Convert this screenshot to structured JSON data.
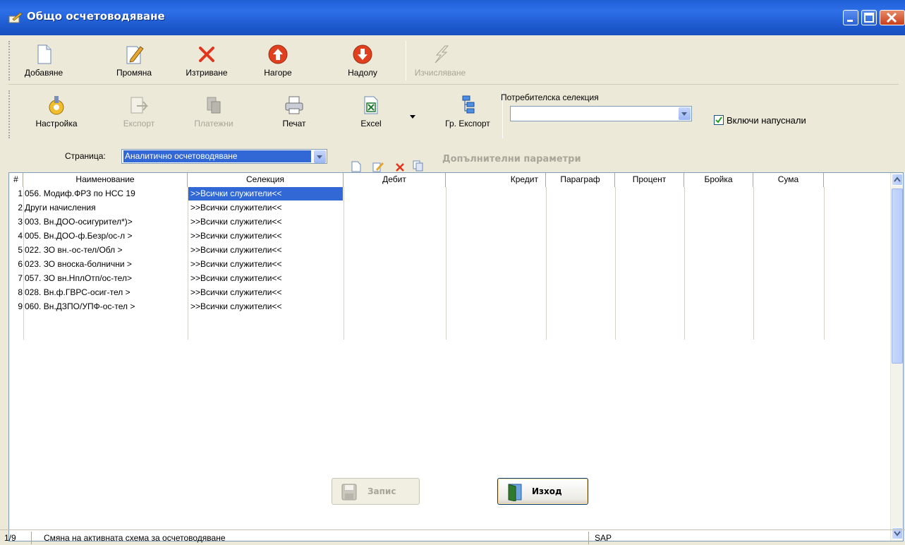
{
  "window": {
    "title": "Общо осчетоводяване"
  },
  "toolbar1": {
    "add": "Добавяне",
    "edit": "Промяна",
    "delete": "Изтриване",
    "up": "Нагоре",
    "down": "Надолу",
    "calculate": "Изчисляване"
  },
  "toolbar2": {
    "settings": "Настройка",
    "export": "Експорт",
    "payments": "Платежни",
    "print": "Печат",
    "excel": "Excel",
    "group_export": "Гр. Експорт",
    "user_selection_label": "Потребителска селекция",
    "user_selection_value": "",
    "include_dismissed_label": "Включи напуснали",
    "include_dismissed_checked": true
  },
  "page": {
    "label": "Страница:",
    "value": "Аналитично осчетоводяване",
    "extra_params": "Допълнителни параметри"
  },
  "grid": {
    "columns": [
      "#",
      "Наименование",
      "Селекция",
      "Дебит",
      "Кредит",
      "Параграф",
      "Процент",
      "Бройка",
      "Сума"
    ],
    "rows": [
      {
        "num": "1",
        "name": "056. Модиф.ФРЗ по НСС 19",
        "selection": ">>Всички служители<<"
      },
      {
        "num": "2",
        "name": "Други начисления",
        "selection": ">>Всички служители<<"
      },
      {
        "num": "3",
        "name": "003. Вн.ДОО-осигурител*)>",
        "selection": ">>Всички служители<<"
      },
      {
        "num": "4",
        "name": "005. Вн.ДОО-ф.Безр/ос-л >",
        "selection": ">>Всички служители<<"
      },
      {
        "num": "5",
        "name": "022. ЗО вн.-ос-тел/Обл >",
        "selection": ">>Всички служители<<"
      },
      {
        "num": "6",
        "name": "023. ЗО вноска-болнични >",
        "selection": ">>Всички служители<<"
      },
      {
        "num": "7",
        "name": "057. ЗО вн.НплОтп/ос-тел>",
        "selection": ">>Всички служители<<"
      },
      {
        "num": "8",
        "name": "028. Вн.ф.ГВРС-осиг-тел >",
        "selection": ">>Всички служители<<"
      },
      {
        "num": "9",
        "name": "060. Вн.ДЗПО/УПФ-ос-тел >",
        "selection": ">>Всички служители<<"
      }
    ]
  },
  "buttons": {
    "save": "Запис",
    "exit": "Изход"
  },
  "status": {
    "position": "1/9",
    "message": "Смяна на активната схема за осчетоводяване",
    "module": "SAP"
  },
  "colors": {
    "titlebar": "#2d6fe8",
    "selection": "#3168d5",
    "background": "#ece9d8"
  }
}
